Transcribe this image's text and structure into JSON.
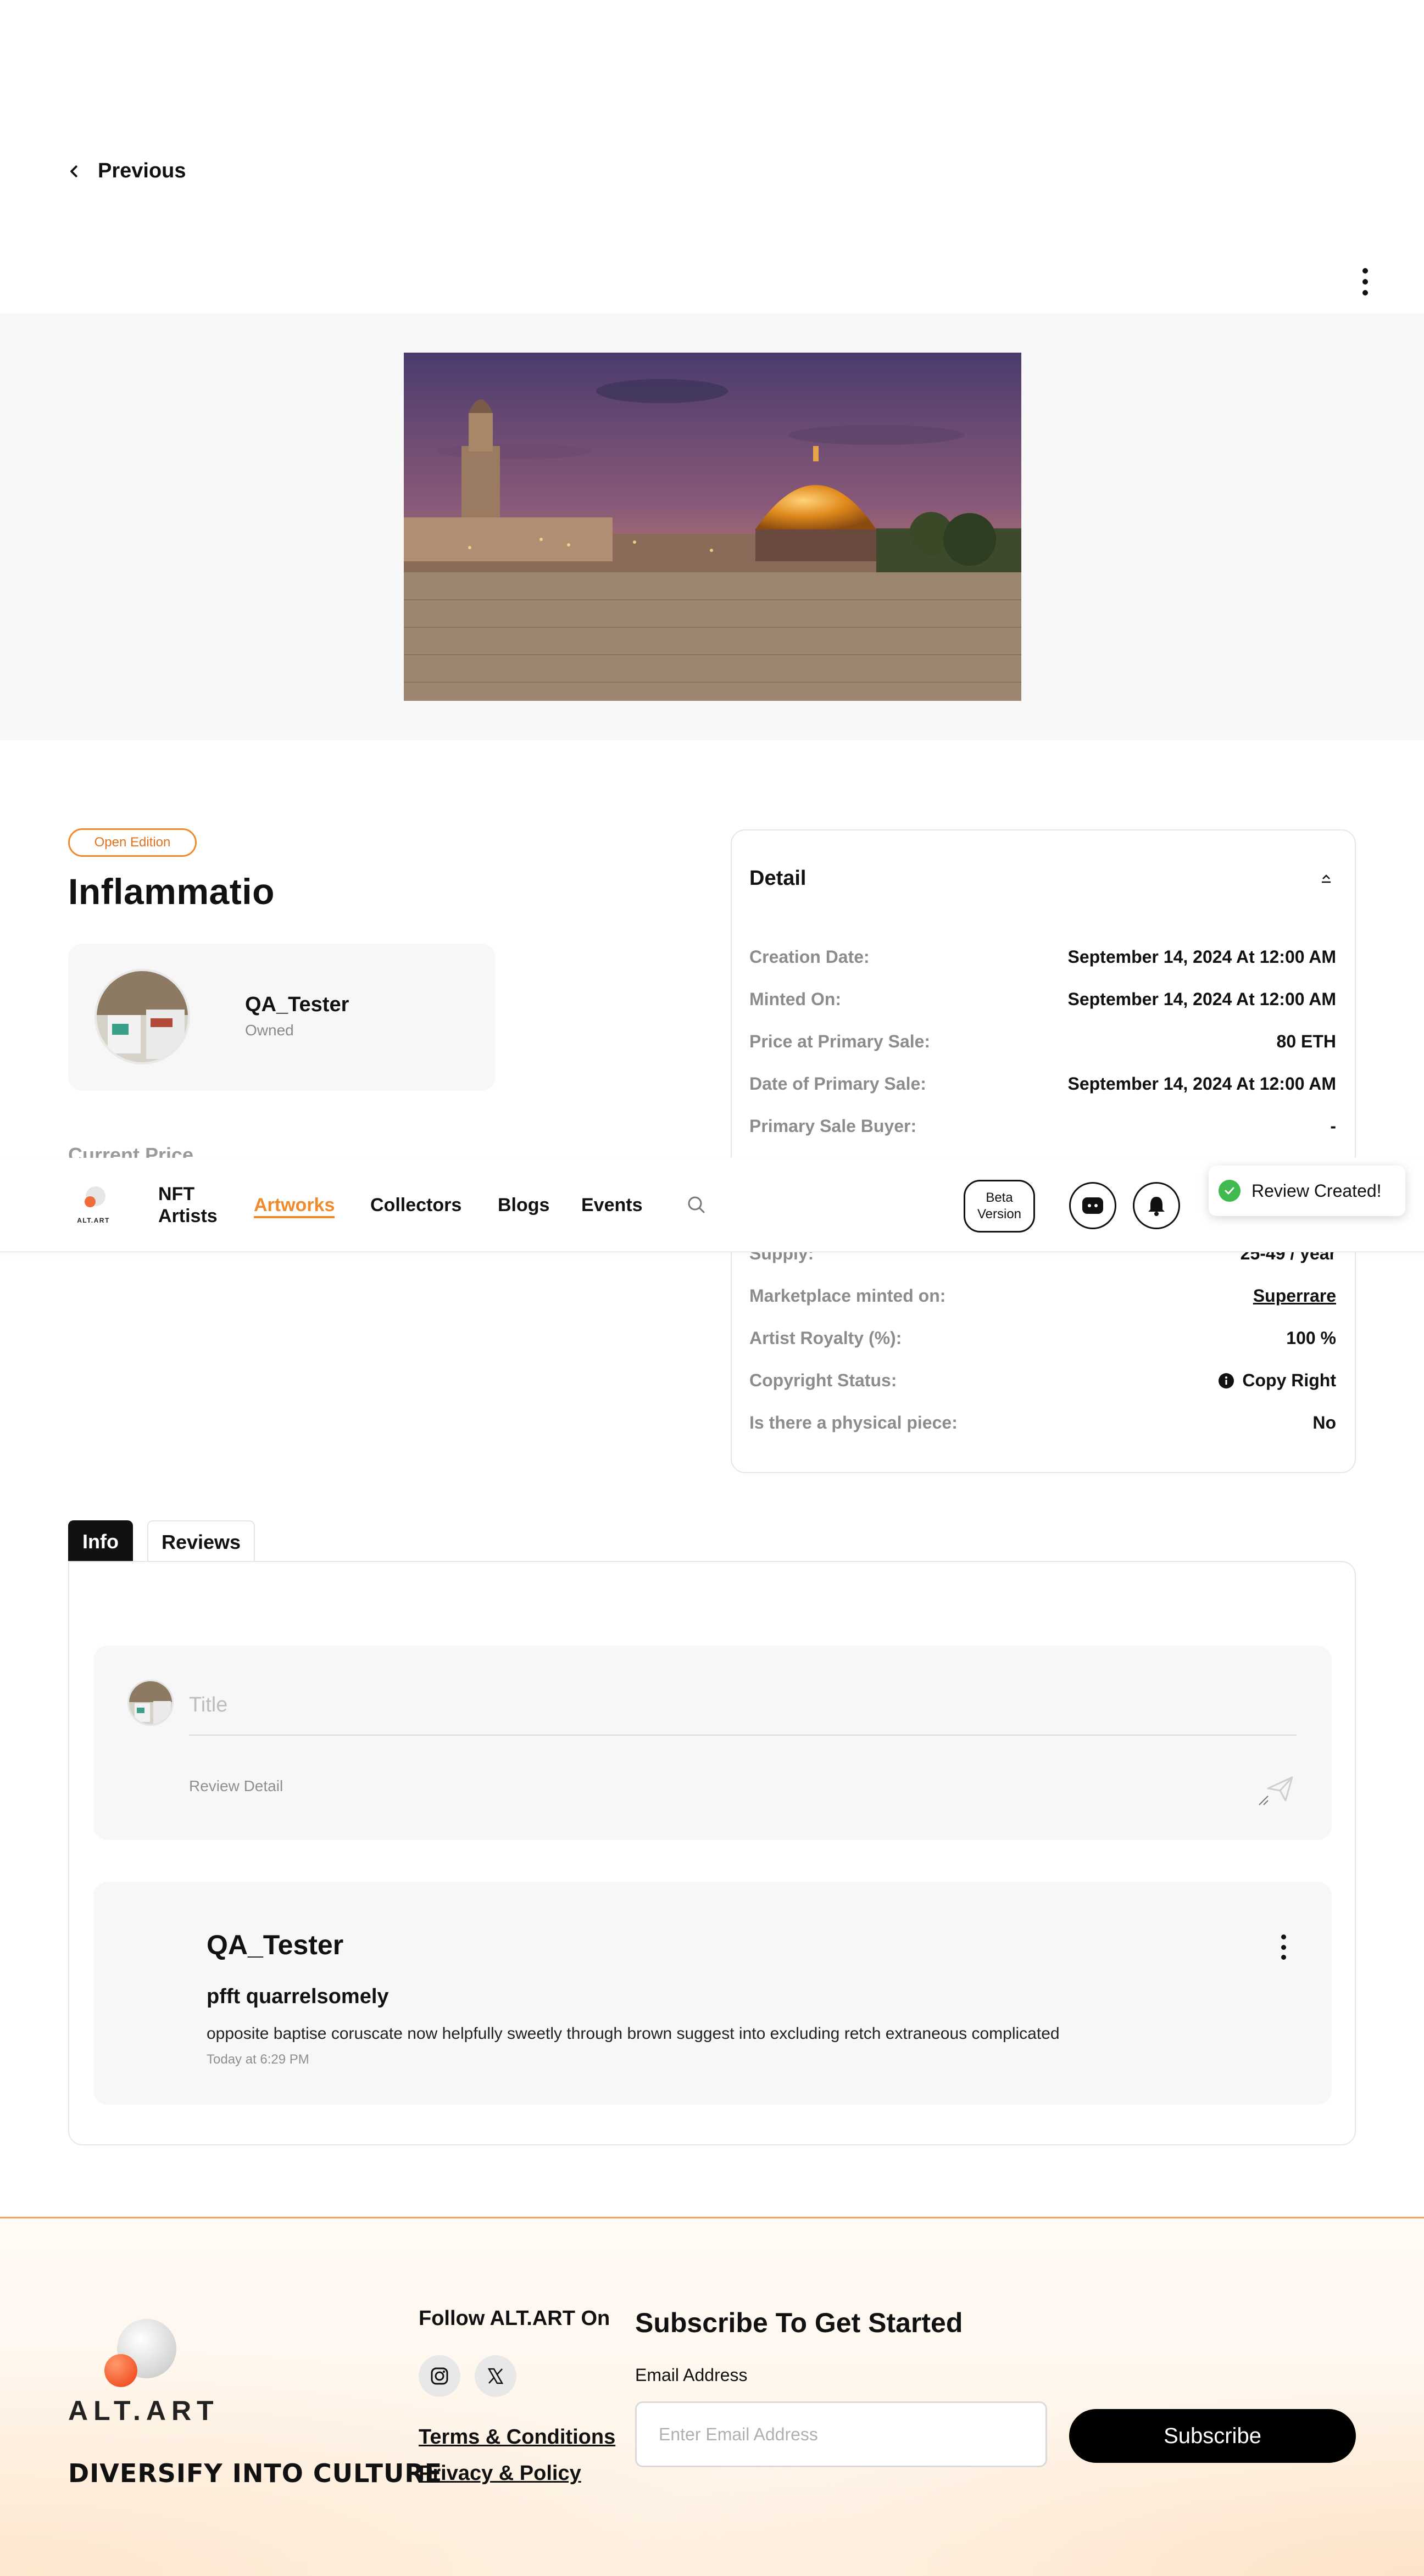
{
  "back": {
    "label": "Previous"
  },
  "artwork": {
    "edition_badge": "Open Edition",
    "title": "Inflammatio",
    "owner_name": "QA_Tester",
    "owner_status": "Owned",
    "current_price_label": "Current Price"
  },
  "detail": {
    "title": "Detail",
    "rows": [
      {
        "label": "Creation Date:",
        "value": "September 14, 2024 At 12:00 AM"
      },
      {
        "label": "Minted On:",
        "value": "September 14, 2024 At 12:00 AM"
      },
      {
        "label": "Price at Primary Sale:",
        "value": "80 ETH"
      },
      {
        "label": "Date of Primary Sale:",
        "value": "September 14, 2024 At 12:00 AM"
      },
      {
        "label": "Primary Sale Buyer:",
        "value": "-"
      },
      {
        "label": "Supply:",
        "value": "25-49 / year"
      },
      {
        "label": "Marketplace minted on:",
        "value": "Superrare"
      },
      {
        "label": "Artist Royalty (%):",
        "value": "100 %"
      },
      {
        "label": "Copyright Status:",
        "value": "Copy Right"
      },
      {
        "label": "Is there a physical piece:",
        "value": "No"
      }
    ]
  },
  "nav": {
    "logo_text": "ALT.ART",
    "items": [
      "NFT Artists",
      "Artworks",
      "Collectors",
      "Blogs",
      "Events"
    ],
    "active": "Artworks",
    "beta_label": "Beta Version",
    "accent_color": "#f08a2a"
  },
  "toast": {
    "message": "Review Created!",
    "color": "#3fb950"
  },
  "tabs": {
    "info": "Info",
    "reviews": "Reviews"
  },
  "review_form": {
    "title_placeholder": "Title",
    "detail_placeholder": "Review Detail"
  },
  "review": {
    "user": "QA_Tester",
    "title": "pfft quarrelsomely",
    "body": "opposite baptise coruscate now helpfully sweetly through brown suggest into excluding retch extraneous complicated",
    "time": "Today at 6:29 PM"
  },
  "footer": {
    "logo_text": "ALT.ART",
    "tagline": "DIVERSIFY INTO CULTURE",
    "follow_label": "Follow ALT.ART On",
    "social": [
      "instagram-icon",
      "x-icon"
    ],
    "terms": "Terms & Conditions",
    "privacy": "Privacy & Policy",
    "subscribe_title": "Subscribe To Get Started",
    "email_label": "Email Address",
    "email_placeholder": "Enter Email Address",
    "subscribe_button": "Subscribe"
  }
}
